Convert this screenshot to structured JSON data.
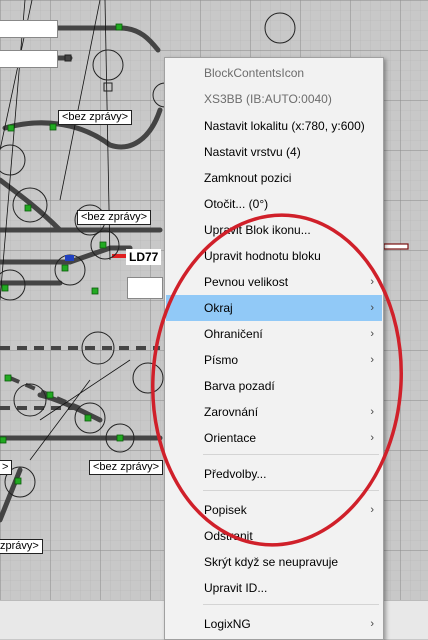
{
  "canvas": {
    "labels": {
      "bubble_1": "<bez zprávy>",
      "bubble_2": "<bez zprávy>",
      "bubble_3": "<bez zprávy>",
      "bubble_4": "zprávy>",
      "bubble_5": ">",
      "block_label": "LD77"
    }
  },
  "context_menu": {
    "items": [
      {
        "label": "BlockContentsIcon",
        "disabled": true
      },
      {
        "label": "XS3BB (IB:AUTO:0040)",
        "disabled": true
      },
      {
        "label": "Nastavit lokalitu (x:780, y:600)"
      },
      {
        "label": "Nastavit vrstvu (4)"
      },
      {
        "label": "Zamknout pozici"
      },
      {
        "label": "Otočit... (0°)"
      },
      {
        "label": "Upravit Blok ikonu..."
      },
      {
        "label": "Upravit hodnotu bloku"
      },
      {
        "label": "Pevnou velikost",
        "submenu": true
      },
      {
        "label": "Okraj",
        "submenu": true,
        "highlighted": true
      },
      {
        "label": "Ohraničení",
        "submenu": true
      },
      {
        "label": "Písmo",
        "submenu": true
      },
      {
        "label": "Barva pozadí"
      },
      {
        "label": "Zarovnání",
        "submenu": true
      },
      {
        "label": "Orientace",
        "submenu": true
      },
      {
        "label": "Předvolby..."
      },
      {
        "label": "Popisek",
        "submenu": true
      },
      {
        "label": "Odstranit"
      },
      {
        "label": "Skrýt když se neupravuje"
      },
      {
        "label": "Upravit ID..."
      },
      {
        "label": "LogixNG",
        "submenu": true
      }
    ],
    "submenu_arrow": "›"
  },
  "colors": {
    "highlight": "#91c9f7",
    "annotation": "#d0202a",
    "track": "#444444",
    "sensor": "#22aa22",
    "grid_bg": "#c8c8c8"
  }
}
